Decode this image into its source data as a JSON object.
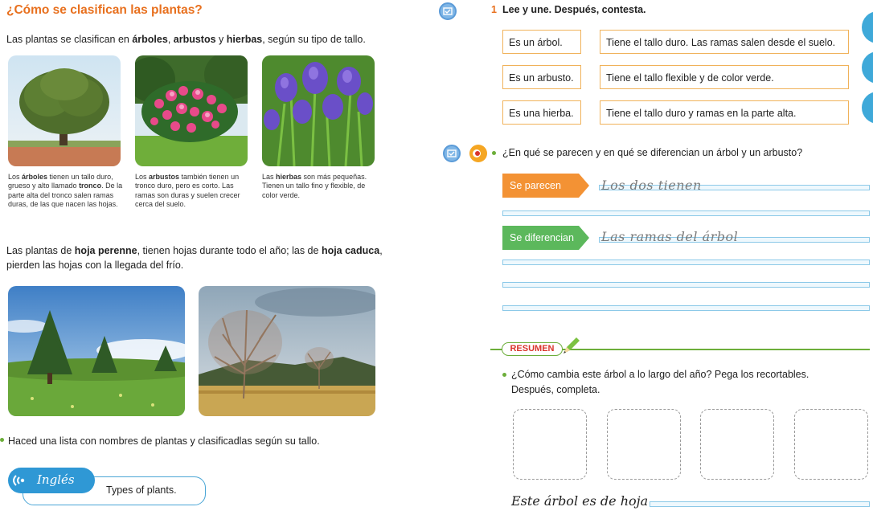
{
  "left": {
    "title": "¿Cómo se clasifican las plantas?",
    "intro": {
      "t1": "Las plantas se clasifican en ",
      "b1": "árboles",
      "t2": ", ",
      "b2": "arbustos",
      "t3": " y ",
      "b3": "hierbas",
      "t4": ", según su tipo de tallo."
    },
    "captions": {
      "tree": [
        "Los ",
        "árboles",
        " tienen un tallo duro, grueso y alto llamado ",
        "tronco",
        ". De la parte alta del tronco salen ramas duras, de las que nacen las hojas."
      ],
      "shrub": [
        "Los ",
        "arbustos",
        " también tienen un tronco duro, pero es corto. Las ramas son duras y suelen crecer cerca del suelo."
      ],
      "herb": [
        "Las ",
        "hierbas",
        " son más pequeñas. Tienen un tallo fino y flexible, de color verde."
      ]
    },
    "leaves": {
      "t1": "Las plantas de ",
      "b1": "hoja perenne",
      "t2": ", tienen hojas durante todo el año; las de ",
      "b2": "hoja caduca",
      "t3": ", pierden las hojas con la llegada del frío."
    },
    "task": "Haced una lista con nombres de plantas y clasificadlas según su tallo.",
    "english": {
      "badge": "Inglés",
      "text": "Types of plants."
    }
  },
  "right": {
    "exercise1": {
      "number": "1",
      "title": "Lee y une. Después, contesta.",
      "left_items": [
        "Es un árbol.",
        "Es un arbusto.",
        "Es una hierba."
      ],
      "right_items": [
        "Tiene el tallo duro. Las ramas salen desde el suelo.",
        "Tiene el tallo flexible y de color verde.",
        "Tiene el tallo duro y ramas en la parte alta."
      ]
    },
    "question": "¿En qué se parecen y en qué se diferencian un árbol y un arbusto?",
    "answers": {
      "similar_label": "Se parecen",
      "similar_text": "Los dos tienen",
      "differ_label": "Se diferencian",
      "differ_text": "Las ramas del árbol"
    },
    "summary": {
      "label": "RESUMEN",
      "question_line1": "¿Cómo cambia este árbol a lo largo del año? Pega los recortables.",
      "question_line2": "Después, completa.",
      "closing": "Este árbol es de hoja"
    }
  },
  "colors": {
    "title": "#e8701e",
    "orange_tag": "#f39234",
    "green_tag": "#5cb85c",
    "line_blue": "#8cc9e8",
    "box_border": "#f0b25a",
    "side_tab": "#3fa9d9"
  }
}
